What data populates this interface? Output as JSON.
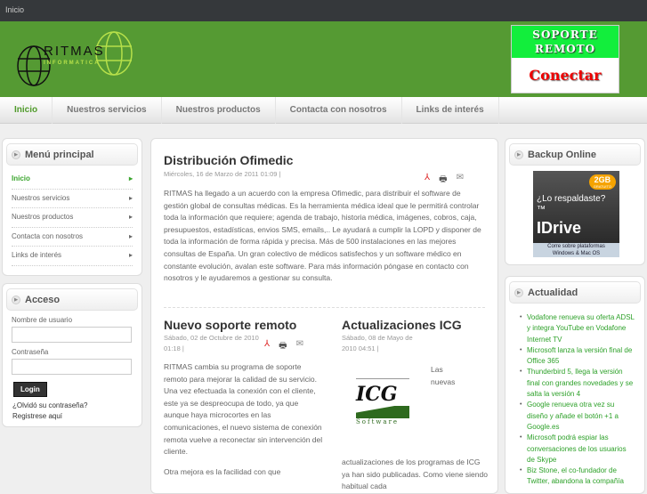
{
  "topbar": {
    "breadcrumb": "Inicio"
  },
  "header": {
    "logo_title": "RITMAS",
    "logo_subtitle": "INFORMATICA",
    "banner_line1": "SOPORTE",
    "banner_line2": "REMOTO",
    "banner_cta": "Conectar"
  },
  "nav": [
    "Inicio",
    "Nuestros servicios",
    "Nuestros productos",
    "Contacta con nosotros",
    "Links de interés"
  ],
  "menu": {
    "title": "Menú principal",
    "items": [
      "Inicio",
      "Nuestros servicios",
      "Nuestros productos",
      "Contacta con nosotros",
      "Links de interés"
    ]
  },
  "login": {
    "title": "Acceso",
    "user_label": "Nombre de usuario",
    "pass_label": "Contraseña",
    "button": "Login",
    "forgot": "¿Olvidó su contraseña?",
    "register": "Registrese aquí"
  },
  "articles": [
    {
      "title": "Distribución Ofimedic",
      "meta": "Miércoles, 16 de Marzo de 2011 01:09 |",
      "body": "RITMAS ha llegado a un acuerdo con la empresa Ofimedic, para distribuir el software de gestión global de consultas médicas. Es la herramienta médica ideal que le permitirá controlar toda la información que requiere; agenda de trabajo, historia médica, imágenes, cobros, caja, presupuestos, estadísticas, envios SMS, emails,.. Le ayudará a cumplir la LOPD y disponer de toda la información de forma rápida y precisa. Más de 500 instalaciones en las mejores consultas de España. Un gran colectivo de médicos satisfechos y un software médico en constante evolución, avalan este software. Para más información póngase en contacto con nosotros y le ayudaremos a gestionar su consulta."
    },
    {
      "title": "Nuevo soporte remoto",
      "meta": "Sábado, 02 de Octubre de 2010 01:18 |",
      "body": "RITMAS cambia su programa de soporte remoto para mejorar la calidad de su servicio. Una vez efectuada la conexión con el cliente, este ya se despreocupa de todo, ya que aunque haya microcortes en las comunicaciones, el nuevo sistema de conexión remota vuelve a reconectar sin intervención del cliente.",
      "body2": "Otra mejora es la facilidad con que"
    },
    {
      "title": "Actualizaciones ICG",
      "meta": "Sábado, 08 de Mayo de 2010 04:51 |",
      "side": "Las nuevas",
      "logo": "ICG",
      "logo_sub": "Software",
      "body": "actualizaciones de los programas de ICG ya han sido publicadas. Como viene siendo habitual cada"
    }
  ],
  "backup": {
    "title": "Backup Online",
    "ad_question": "¿Lo respaldaste?™",
    "ad_badge": "2GB",
    "ad_badge_sub": "GRATUITO",
    "ad_brand": "IDrive",
    "ad_footer1": "Corre sobre plataformas",
    "ad_footer2": "Windows & Mac OS"
  },
  "news": {
    "title": "Actualidad",
    "items": [
      "Vodafone renueva su oferta ADSL y integra YouTube en Vodafone Internet TV",
      "Microsoft lanza la versión final de Office 365",
      "Thunderbird 5, llega la versión final con grandes novedades y se salta la versión 4",
      "Google renueva otra vez su diseño y añade el botón +1 a Google.es",
      "Microsoft podrá espiar las conversaciones de los usuarios de Skype",
      "Biz Stone, el co-fundador de Twitter, abandona la compañía"
    ]
  }
}
